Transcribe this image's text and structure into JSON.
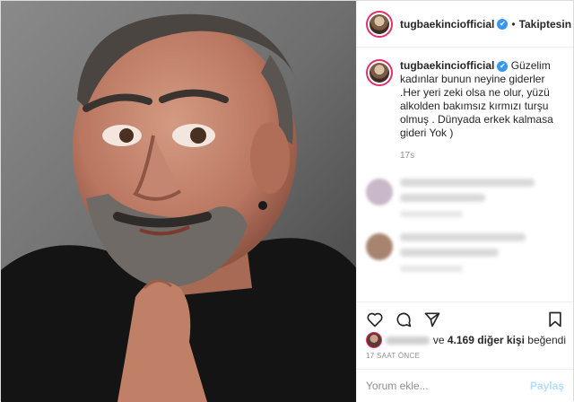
{
  "post": {
    "username": "tugbaekinciofficial",
    "verified_mark": "✔",
    "separator": "•",
    "follow_state": "Takiptesin"
  },
  "caption": {
    "username": "tugbaekinciofficial",
    "text": " Güzelim kadınlar bunun neyine giderler .Her yeri zeki olsa ne olur, yüzü alkolden bakımsız kırmızı turşu olmuş . Dünyada erkek kalmasa gideri Yok )",
    "time": "17s"
  },
  "icons": {
    "like": "heart-icon",
    "comment": "comment-bubble-icon",
    "share": "paper-plane-icon",
    "save": "bookmark-icon"
  },
  "likes": {
    "connector": "ve",
    "count_text": "4.169 diğer kişi",
    "suffix": "beğendi"
  },
  "timestamp": "17 SAAT ÖNCE",
  "add_comment": {
    "placeholder": "Yorum ekle...",
    "post_label": "Paylaş"
  },
  "colors": {
    "verified": "#3897f0",
    "post_button": "#b2dffc",
    "story_ring": "#e1306c"
  }
}
